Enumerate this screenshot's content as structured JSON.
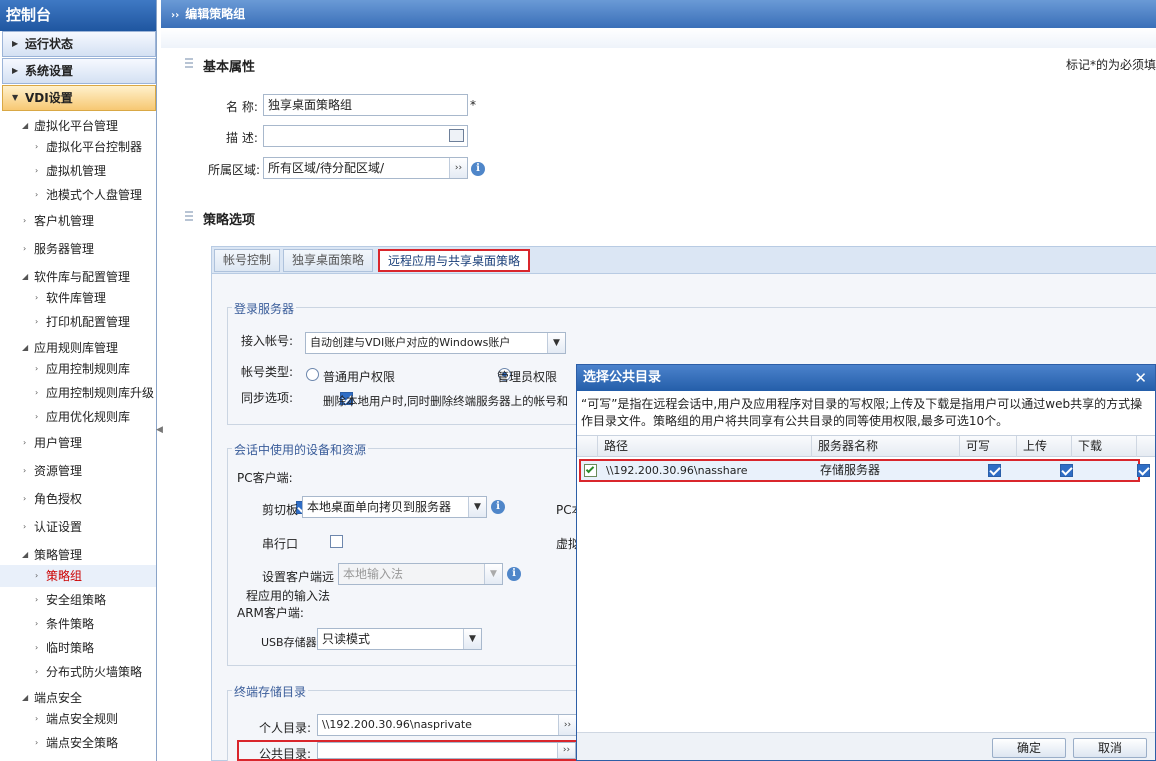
{
  "sidebar": {
    "title": "控制台",
    "sections": [
      {
        "label": "运行状态"
      },
      {
        "label": "系统设置"
      },
      {
        "label": "VDI设置"
      }
    ],
    "tree": [
      "虚拟化平台管理",
      "虚拟化平台控制器",
      "虚拟机管理",
      "池模式个人盘管理",
      "客户机管理",
      "服务器管理",
      "软件库与配置管理",
      "软件库管理",
      "打印机配置管理",
      "应用规则库管理",
      "应用控制规则库",
      "应用控制规则库升级",
      "应用优化规则库",
      "用户管理",
      "资源管理",
      "角色授权",
      "认证设置",
      "策略管理",
      "策略组",
      "安全组策略",
      "条件策略",
      "临时策略",
      "分布式防火墙策略",
      "端点安全",
      "端点安全规则",
      "端点安全策略"
    ]
  },
  "header": {
    "title": "编辑策略组"
  },
  "basic": {
    "title": "基本属性",
    "required_note": "标记*的为必须填",
    "name_label": "名 称:",
    "name_value": "独享桌面策略组",
    "required_mark": "*",
    "desc_label": "描 述:",
    "desc_value": "",
    "region_label": "所属区域:",
    "region_value": "所有区域/待分配区域/"
  },
  "policy": {
    "title": "策略选项",
    "tabs": [
      "帐号控制",
      "独享桌面策略",
      "远程应用与共享桌面策略"
    ]
  },
  "login": {
    "legend": "登录服务器",
    "account_label": "接入帐号:",
    "account_value": "自动创建与VDI账户对应的Windows账户",
    "type_label": "帐号类型:",
    "type_normal": "普通用户权限",
    "type_admin": "管理员权限",
    "sync_label": "同步选项:",
    "sync_text": "删除本地用户时,同时删除终端服务器上的帐号和"
  },
  "devices": {
    "legend": "会话中使用的设备和资源",
    "pc_client": "PC客户端:",
    "clipboard_label": "剪切板",
    "clipboard_value": "本地桌面单向拷贝到服务器",
    "pc_local_label": "PC本",
    "serial_label": "串行口",
    "virtual_label": "虚拟",
    "ime_label_1": "设置客户端远",
    "ime_label_2": "程应用的输入法",
    "ime_value": "本地输入法",
    "arm_client": "ARM客户端:",
    "usb_label": "USB存储器",
    "usb_value": "只读模式"
  },
  "storage": {
    "legend": "终端存储目录",
    "personal_label": "个人目录:",
    "personal_value": "\\\\192.200.30.96\\nasprivate",
    "public_label": "公共目录:",
    "public_value": ""
  },
  "dialog": {
    "title": "选择公共目录",
    "close": "✕",
    "desc": "“可写”是指在远程会话中,用户及应用程序对目录的写权限;上传及下载是指用户可以通过web共享的方式操作目录文件。策略组的用户将共同享有公共目录的同等使用权限,最多可选10个。",
    "columns": [
      "路径",
      "服务器名称",
      "可写",
      "上传",
      "下载"
    ],
    "row": {
      "path": "\\\\192.200.30.96\\nasshare",
      "server": "存储服务器"
    },
    "ok": "确定",
    "cancel": "取消"
  },
  "colors": {
    "accent": "#2f6dc5",
    "highlight": "#d9262c",
    "header": "#3a6fb8"
  }
}
